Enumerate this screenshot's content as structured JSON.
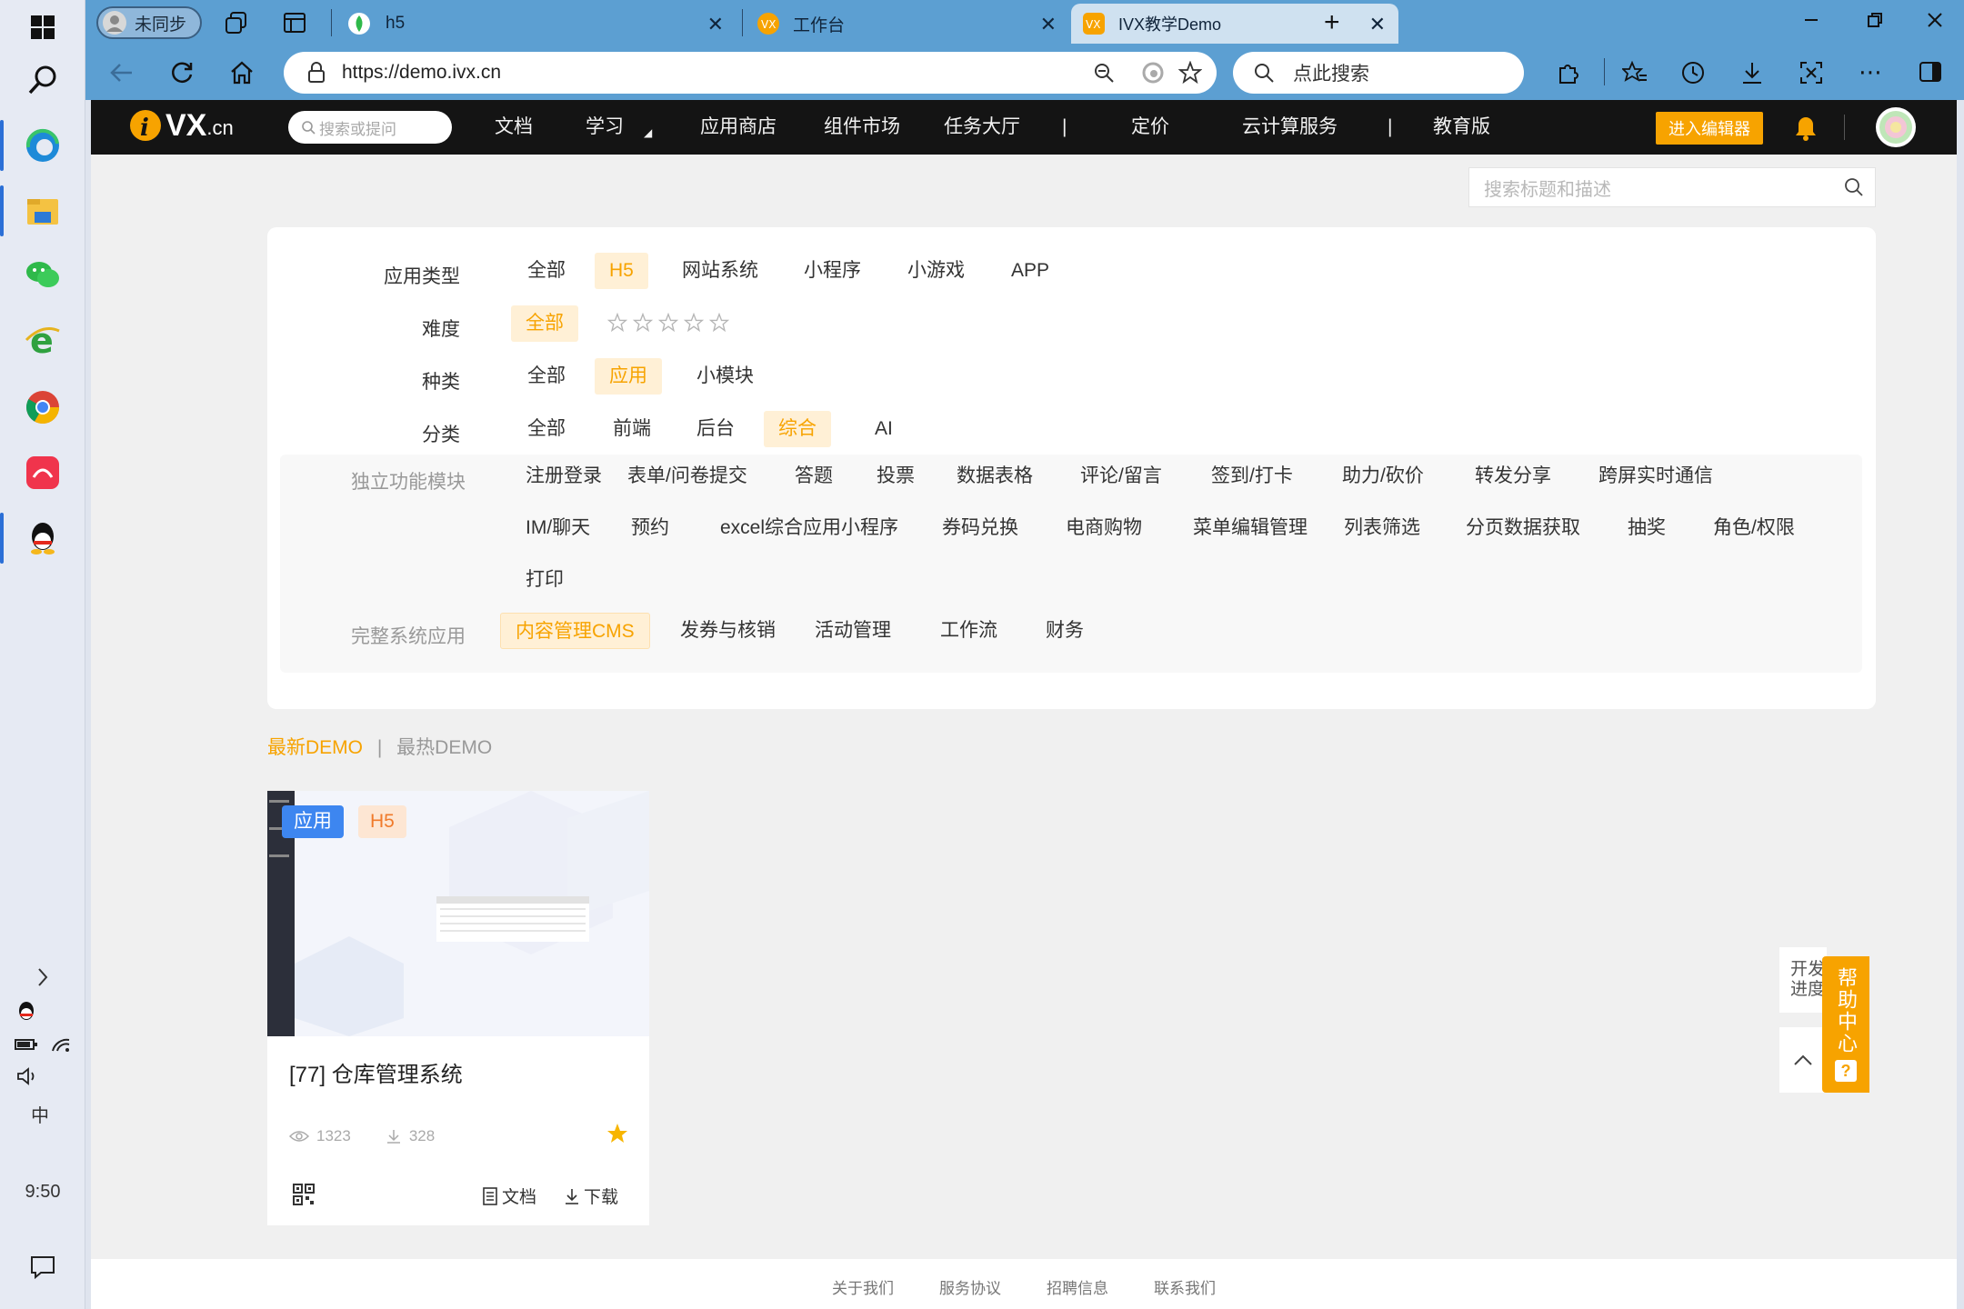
{
  "taskbar": {
    "clock": "9:50",
    "ime": "中"
  },
  "browser": {
    "profile_label": "未同步",
    "tabs": [
      {
        "title": "h5"
      },
      {
        "title": "工作台"
      },
      {
        "title": "IVX教学Demo"
      }
    ],
    "url": "https://demo.ivx.cn",
    "search_placeholder": "点此搜索"
  },
  "site_nav": {
    "logo_text": "VX",
    "logo_suffix": ".cn",
    "search_placeholder": "搜索或提问",
    "items": [
      "文档",
      "学习",
      "应用商店",
      "组件市场",
      "任务大厅",
      "定价",
      "云计算服务",
      "教育版"
    ],
    "separator": "|",
    "editor_button": "进入编辑器"
  },
  "page": {
    "top_search_placeholder": "搜索标题和描述",
    "filters": {
      "app_type": {
        "label": "应用类型",
        "options": [
          "全部",
          "H5",
          "网站系统",
          "小程序",
          "小游戏",
          "APP"
        ],
        "selected": "H5"
      },
      "difficulty": {
        "label": "难度",
        "options": [
          "全部"
        ],
        "selected": "全部",
        "stars": 5
      },
      "kind": {
        "label": "种类",
        "options": [
          "全部",
          "应用",
          "小模块"
        ],
        "selected": "应用"
      },
      "category": {
        "label": "分类",
        "options": [
          "全部",
          "前端",
          "后台",
          "综合",
          "AI"
        ],
        "selected": "综合"
      },
      "modules": {
        "label": "独立功能模块",
        "options": [
          "注册登录",
          "表单/问卷提交",
          "答题",
          "投票",
          "数据表格",
          "评论/留言",
          "签到/打卡",
          "助力/砍价",
          "转发分享",
          "跨屏实时通信",
          "IM/聊天",
          "预约",
          "excel综合应用小程序",
          "券码兑换",
          "电商购物",
          "菜单编辑管理",
          "列表筛选",
          "分页数据获取",
          "抽奖",
          "角色/权限",
          "打印"
        ]
      },
      "systems": {
        "label": "完整系统应用",
        "options": [
          "内容管理CMS",
          "发券与核销",
          "活动管理",
          "工作流",
          "财务"
        ],
        "selected": "内容管理CMS"
      }
    },
    "demo_tabs": {
      "latest": "最新DEMO",
      "hot": "最热DEMO",
      "divider": "|"
    },
    "card": {
      "badge_kind": "应用",
      "badge_type": "H5",
      "title": "[77] 仓库管理系统",
      "views": "1323",
      "downloads": "328",
      "doc_label": "文档",
      "download_label": "下载"
    },
    "side": {
      "dev_progress": "开发进度",
      "help_center": "帮助中心"
    },
    "footer_links": [
      "关于我们",
      "服务协议",
      "招聘信息",
      "联系我们"
    ]
  },
  "colors": {
    "accent": "#f7a300",
    "nav_bg": "#141414",
    "browser_chrome": "#5c9fd2",
    "badge_blue": "#3d86f0"
  }
}
